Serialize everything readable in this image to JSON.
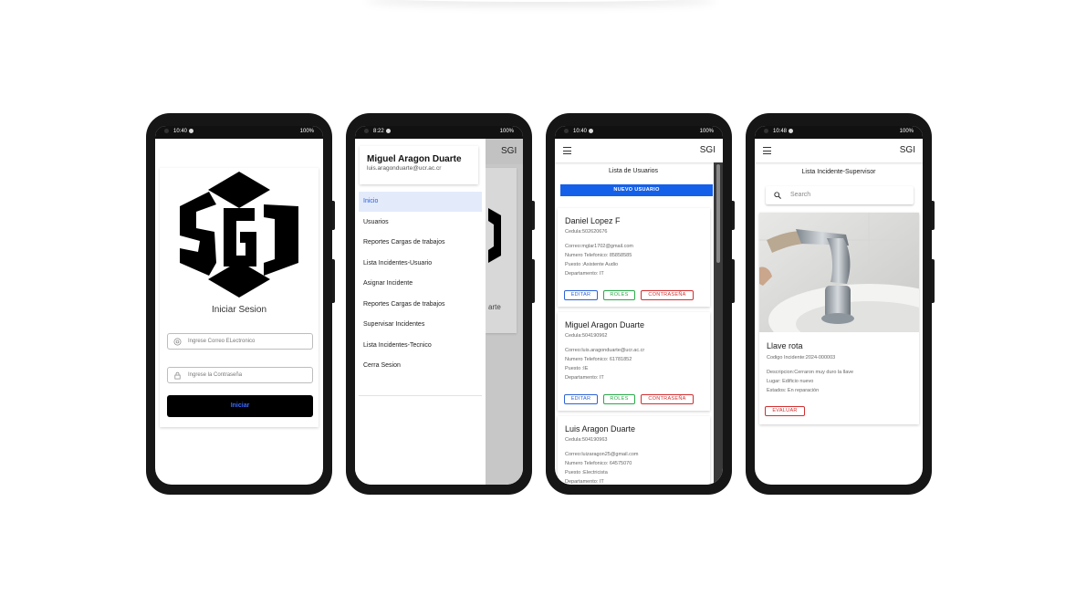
{
  "status_bars": [
    {
      "time": "10:40",
      "battery": "100%"
    },
    {
      "time": "8:22",
      "battery": "100%"
    },
    {
      "time": "10:40",
      "battery": "100%"
    },
    {
      "time": "10:48",
      "battery": "100%"
    }
  ],
  "app": {
    "name": "SGI"
  },
  "login": {
    "title": "Iniciar Sesion",
    "email_placeholder": "Ingrese Correo ELectronico",
    "password_placeholder": "Ingrese la Contraseña",
    "submit_label": "Iniciar"
  },
  "drawer": {
    "user_name": "Miguel Aragon Duarte",
    "user_email": "luis.aragonduarte@ucr.ac.cr",
    "items": [
      {
        "label": "Inicio"
      },
      {
        "label": "Usuarios"
      },
      {
        "label": "Reportes Cargas de trabajos"
      },
      {
        "label": "Lista Incidentes-Usuario"
      },
      {
        "label": "Asignar Incidente"
      },
      {
        "label": "Reportes Cargas de trabajos"
      },
      {
        "label": "Supervisar Incidentes"
      },
      {
        "label": "Lista Incidentes-Tecnico"
      },
      {
        "label": "Cerra Sesion"
      }
    ],
    "background_partial_text": "arte"
  },
  "users": {
    "title": "Lista de Usuarios",
    "new_button": "NUEVO USUARIO",
    "actions": {
      "edit": "EDITAR",
      "roles": "ROLES",
      "password": "CONTRASEÑA"
    },
    "list": [
      {
        "name": "Daniel Lopez F",
        "cedula": "Cedula:502620676",
        "lines": [
          "Correo:mglar1702@gmail.com",
          "Numero Telefonico: 85858585",
          "Puesto :Asistente Audio",
          "Departamento: IT"
        ]
      },
      {
        "name": "Miguel Aragon Duarte",
        "cedula": "Cedula:504190962",
        "lines": [
          "Correo:luis.aragonduarte@ucr.ac.cr",
          "Numero Telefonico: 61781852",
          "Puesto :IE",
          "Departamento: IT"
        ]
      },
      {
        "name": "Luis Aragon Duarte",
        "cedula": "Cedula:504190963",
        "lines": [
          "Correo:luizaragon25@gmail.com",
          "Numero Telefonico: 64575070",
          "Puesto :Electricista",
          "Departamento: IT"
        ]
      }
    ]
  },
  "incidents": {
    "title": "Lista Incidente-Supervisor",
    "search_placeholder": "Search",
    "card": {
      "title": "Llave rota",
      "code": "Codigo Incidente:2024-000003",
      "description": "Descripcion:Cerraron muy duro la llave",
      "place": "Lugar: Edificio nuevo",
      "state": "Estados: En reparación",
      "action": "EVALUAR"
    }
  },
  "colors": {
    "primary": "#1560e8",
    "success": "#2aa84a",
    "danger": "#d32f2f",
    "drawer_active": "#e3ebfb"
  }
}
